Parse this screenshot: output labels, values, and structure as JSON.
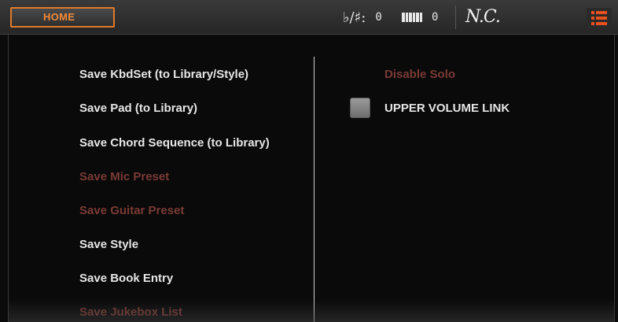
{
  "header": {
    "home_label": "HOME",
    "transpose_symbol": "♭/♯:",
    "transpose_value": "0",
    "octave_icon": "keyboard-icon",
    "octave_value": "0",
    "chord": "N.C.",
    "menu_icon": "page-menu-icon"
  },
  "colors": {
    "accent": "#e07a2a",
    "menu_icon": "#e6501e",
    "enabled_text": "#e6e6e6",
    "disabled_text": "#7a3a35"
  },
  "left_menu": {
    "items": [
      {
        "label": "Save KbdSet (to Library/Style)",
        "enabled": true
      },
      {
        "label": "Save Pad (to Library)",
        "enabled": true
      },
      {
        "label": "Save Chord Sequence (to Library)",
        "enabled": true
      },
      {
        "label": "Save Mic Preset",
        "enabled": false
      },
      {
        "label": "Save Guitar Preset",
        "enabled": false
      },
      {
        "label": "Save Style",
        "enabled": true
      },
      {
        "label": "Save Book Entry",
        "enabled": true
      },
      {
        "label": "Save Jukebox List",
        "enabled": false
      }
    ]
  },
  "right_menu": {
    "disable_solo": "Disable Solo",
    "upper_volume_link": "UPPER VOLUME LINK",
    "upper_volume_link_checked": false
  }
}
